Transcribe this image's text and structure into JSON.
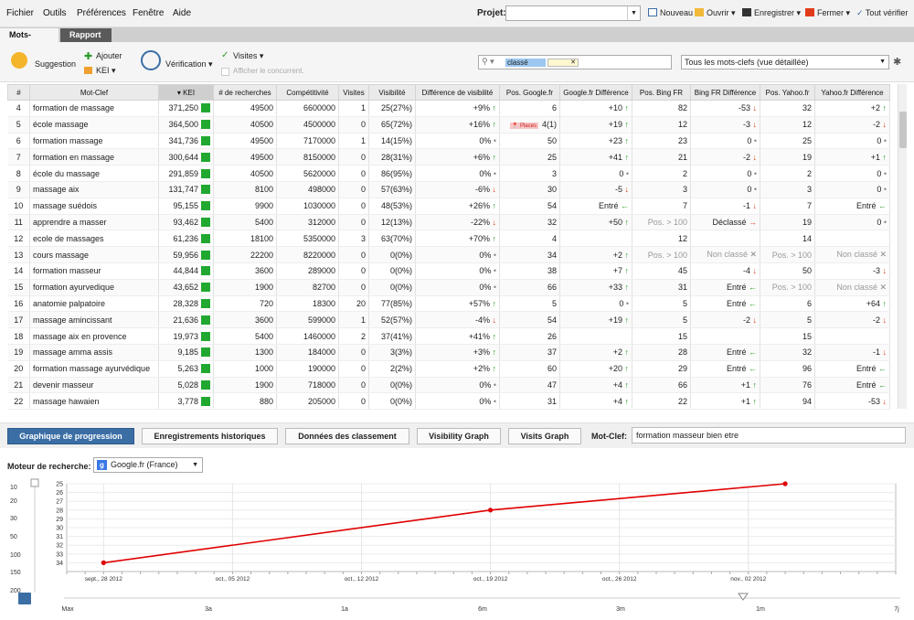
{
  "menu": {
    "items": [
      "Fichier",
      "Outils",
      "Préférences",
      "Fenêtre",
      "Aide"
    ],
    "projet_label": "Projet:",
    "projet_value": ""
  },
  "toolbar": {
    "nouveau": "Nouveau",
    "ouvrir": "Ouvrir",
    "enregistrer": "Enregistrer",
    "fermer": "Fermer",
    "tout_verifier": "Tout vérifier"
  },
  "tabs": [
    "Mots-Clefs",
    "Rapport"
  ],
  "actions": {
    "suggestion": "Suggestion",
    "ajouter": "Ajouter",
    "kei": "KEI",
    "verification": "Vérification",
    "visites": "Visites",
    "afficher": "Afficher le concurrent."
  },
  "filter": {
    "chip": "classé",
    "chip2": "",
    "view": "Tous les mots-clefs (vue détaillée)"
  },
  "colors": {
    "accent": "#3a6ea5",
    "up": "#2a9a2a",
    "down": "#e23b1a",
    "kei": "#21a830",
    "chart_line": "#e00000"
  },
  "columns": [
    "#",
    "Mot-Clef",
    "KEI",
    "# de recherches",
    "Compétitivité",
    "Visites",
    "Visibilité",
    "Différence de visibilité",
    "Pos. Google.fr",
    "Google.fr Différence",
    "Pos. Bing FR",
    "Bing FR Différence",
    "Pos. Yahoo.fr",
    "Yahoo.fr Différence"
  ],
  "rows": [
    {
      "n": "4",
      "kw": "formation de massage",
      "kei": "371,250",
      "rech": "49500",
      "comp": "6600000",
      "vis": "1",
      "visib": "25(27%)",
      "dvis": "+9%",
      "dvis_t": "up",
      "g": "6",
      "gd": "+10",
      "gd_t": "up",
      "b": "82",
      "bd": "-53",
      "bd_t": "dn",
      "y": "32",
      "yd": "+2",
      "yd_t": "up"
    },
    {
      "n": "5",
      "kw": "école massage",
      "kei": "364,500",
      "rech": "40500",
      "comp": "4500000",
      "vis": "0",
      "visib": "65(72%)",
      "dvis": "+16%",
      "dvis_t": "up",
      "g": "4(1)",
      "places": "Places",
      "gd": "+19",
      "gd_t": "up",
      "b": "12",
      "bd": "-3",
      "bd_t": "dn",
      "y": "12",
      "yd": "-2",
      "yd_t": "dn"
    },
    {
      "n": "6",
      "kw": "formation massage",
      "kei": "341,736",
      "rech": "49500",
      "comp": "7170000",
      "vis": "1",
      "visib": "14(15%)",
      "dvis": "0%",
      "dvis_t": "dot",
      "g": "50",
      "gd": "+23",
      "gd_t": "up",
      "b": "23",
      "bd": "0",
      "bd_t": "dot",
      "y": "25",
      "yd": "0",
      "yd_t": "dot"
    },
    {
      "n": "7",
      "kw": "formation en massage",
      "kei": "300,644",
      "rech": "49500",
      "comp": "8150000",
      "vis": "0",
      "visib": "28(31%)",
      "dvis": "+6%",
      "dvis_t": "up",
      "g": "25",
      "gd": "+41",
      "gd_t": "up",
      "b": "21",
      "bd": "-2",
      "bd_t": "dn",
      "y": "19",
      "yd": "+1",
      "yd_t": "up"
    },
    {
      "n": "8",
      "kw": "école du massage",
      "kei": "291,859",
      "rech": "40500",
      "comp": "5620000",
      "vis": "0",
      "visib": "86(95%)",
      "dvis": "0%",
      "dvis_t": "dot",
      "g": "3",
      "gd": "0",
      "gd_t": "dot",
      "b": "2",
      "bd": "0",
      "bd_t": "dot",
      "y": "2",
      "yd": "0",
      "yd_t": "dot"
    },
    {
      "n": "9",
      "kw": "massage aix",
      "kei": "131,747",
      "rech": "8100",
      "comp": "498000",
      "vis": "0",
      "visib": "57(63%)",
      "dvis": "-6%",
      "dvis_t": "dn",
      "g": "30",
      "gd": "-5",
      "gd_t": "dn",
      "b": "3",
      "bd": "0",
      "bd_t": "dot",
      "y": "3",
      "yd": "0",
      "yd_t": "dot"
    },
    {
      "n": "10",
      "kw": "massage suédois",
      "kei": "95,155",
      "rech": "9900",
      "comp": "1030000",
      "vis": "0",
      "visib": "48(53%)",
      "dvis": "+26%",
      "dvis_t": "up",
      "g": "54",
      "gd": "Entré",
      "gd_t": "in",
      "b": "7",
      "bd": "-1",
      "bd_t": "dn",
      "y": "7",
      "yd": "Entré",
      "yd_t": "in"
    },
    {
      "n": "11",
      "kw": "apprendre a masser",
      "kei": "93,462",
      "rech": "5400",
      "comp": "312000",
      "vis": "0",
      "visib": "12(13%)",
      "dvis": "-22%",
      "dvis_t": "dn",
      "g": "32",
      "gd": "+50",
      "gd_t": "up",
      "b": "Pos. > 100",
      "b_gray": true,
      "bd": "Déclassé",
      "bd_t": "out",
      "y": "19",
      "yd": "0",
      "yd_t": "dot"
    },
    {
      "n": "12",
      "kw": "ecole de massages",
      "kei": "61,236",
      "rech": "18100",
      "comp": "5350000",
      "vis": "3",
      "visib": "63(70%)",
      "dvis": "+70%",
      "dvis_t": "up",
      "g": "4",
      "gd": "",
      "gd_t": "",
      "b": "12",
      "bd": "",
      "bd_t": "",
      "y": "14",
      "yd": "",
      "yd_t": ""
    },
    {
      "n": "13",
      "kw": "cours massage",
      "kei": "59,956",
      "rech": "22200",
      "comp": "8220000",
      "vis": "0",
      "visib": "0(0%)",
      "dvis": "0%",
      "dvis_t": "dot",
      "g": "34",
      "gd": "+2",
      "gd_t": "up",
      "b": "Pos. > 100",
      "b_gray": true,
      "bd": "Non classé",
      "bd_t": "x",
      "y": "Pos. > 100",
      "y_gray": true,
      "yd": "Non classé",
      "yd_t": "x"
    },
    {
      "n": "14",
      "kw": "formation masseur",
      "kei": "44,844",
      "rech": "3600",
      "comp": "289000",
      "vis": "0",
      "visib": "0(0%)",
      "dvis": "0%",
      "dvis_t": "dot",
      "g": "38",
      "gd": "+7",
      "gd_t": "up",
      "b": "45",
      "bd": "-4",
      "bd_t": "dn",
      "y": "50",
      "yd": "-3",
      "yd_t": "dn"
    },
    {
      "n": "15",
      "kw": "formation ayurvedique",
      "kei": "43,652",
      "rech": "1900",
      "comp": "82700",
      "vis": "0",
      "visib": "0(0%)",
      "dvis": "0%",
      "dvis_t": "dot",
      "g": "66",
      "gd": "+33",
      "gd_t": "up",
      "b": "31",
      "bd": "Entré",
      "bd_t": "in",
      "y": "Pos. > 100",
      "y_gray": true,
      "yd": "Non classé",
      "yd_t": "x"
    },
    {
      "n": "16",
      "kw": "anatomie palpatoire",
      "kei": "28,328",
      "rech": "720",
      "comp": "18300",
      "vis": "20",
      "visib": "77(85%)",
      "dvis": "+57%",
      "dvis_t": "up",
      "g": "5",
      "gd": "0",
      "gd_t": "dot",
      "b": "5",
      "bd": "Entré",
      "bd_t": "in",
      "y": "6",
      "yd": "+64",
      "yd_t": "up"
    },
    {
      "n": "17",
      "kw": "massage amincissant",
      "kei": "21,636",
      "rech": "3600",
      "comp": "599000",
      "vis": "1",
      "visib": "52(57%)",
      "dvis": "-4%",
      "dvis_t": "dn",
      "g": "54",
      "gd": "+19",
      "gd_t": "up",
      "b": "5",
      "bd": "-2",
      "bd_t": "dn",
      "y": "5",
      "yd": "-2",
      "yd_t": "dn"
    },
    {
      "n": "18",
      "kw": "massage aix en provence",
      "kei": "19,973",
      "rech": "5400",
      "comp": "1460000",
      "vis": "2",
      "visib": "37(41%)",
      "dvis": "+41%",
      "dvis_t": "up",
      "g": "26",
      "gd": "",
      "gd_t": "",
      "b": "15",
      "bd": "",
      "bd_t": "",
      "y": "15",
      "yd": "",
      "yd_t": ""
    },
    {
      "n": "19",
      "kw": "massage amma assis",
      "kei": "9,185",
      "rech": "1300",
      "comp": "184000",
      "vis": "0",
      "visib": "3(3%)",
      "dvis": "+3%",
      "dvis_t": "up",
      "g": "37",
      "gd": "+2",
      "gd_t": "up",
      "b": "28",
      "bd": "Entré",
      "bd_t": "in",
      "y": "32",
      "yd": "-1",
      "yd_t": "dn"
    },
    {
      "n": "20",
      "kw": "formation massage ayurvédique",
      "kei": "5,263",
      "rech": "1000",
      "comp": "190000",
      "vis": "0",
      "visib": "2(2%)",
      "dvis": "+2%",
      "dvis_t": "up",
      "g": "60",
      "gd": "+20",
      "gd_t": "up",
      "b": "29",
      "bd": "Entré",
      "bd_t": "in",
      "y": "96",
      "yd": "Entré",
      "yd_t": "in"
    },
    {
      "n": "21",
      "kw": "devenir masseur",
      "kei": "5,028",
      "rech": "1900",
      "comp": "718000",
      "vis": "0",
      "visib": "0(0%)",
      "dvis": "0%",
      "dvis_t": "dot",
      "g": "47",
      "gd": "+4",
      "gd_t": "up",
      "b": "66",
      "bd": "+1",
      "bd_t": "up",
      "y": "76",
      "yd": "Entré",
      "yd_t": "in"
    },
    {
      "n": "22",
      "kw": "massage hawaien",
      "kei": "3,778",
      "rech": "880",
      "comp": "205000",
      "vis": "0",
      "visib": "0(0%)",
      "dvis": "0%",
      "dvis_t": "dot",
      "g": "31",
      "gd": "+4",
      "gd_t": "up",
      "b": "22",
      "bd": "+1",
      "bd_t": "up",
      "y": "94",
      "yd": "-53",
      "yd_t": "dn"
    }
  ],
  "bottom_tabs": [
    "Graphique de progression",
    "Enregistrements historiques",
    "Données des classement",
    "Visibility Graph",
    "Visits Graph"
  ],
  "keyword": {
    "label": "Mot-Clef:",
    "value": "formation masseur bien etre"
  },
  "engine": {
    "label": "Moteur de recherche:",
    "value": "Google.fr (France)"
  },
  "chart_data": {
    "type": "line",
    "y_inverted": true,
    "ylim": [
      35,
      25
    ],
    "yticks": [
      "25",
      "26",
      "27",
      "28",
      "29",
      "30",
      "31",
      "32",
      "33",
      "34"
    ],
    "left_scale": [
      "10",
      "20",
      "30",
      "50",
      "100",
      "150",
      "200"
    ],
    "x": [
      "2012-09-28",
      "2012-10-19",
      "2012-11-04"
    ],
    "values": [
      34,
      28,
      25
    ],
    "xticks": [
      "sept., 28 2012",
      "oct., 05 2012",
      "oct., 12 2012",
      "oct., 19 2012",
      "oct., 26 2012",
      "nov., 02 2012"
    ],
    "range_labels": [
      "Max",
      "3a",
      "1a",
      "6m",
      "3m",
      "1m",
      "7j"
    ],
    "grid": true
  }
}
